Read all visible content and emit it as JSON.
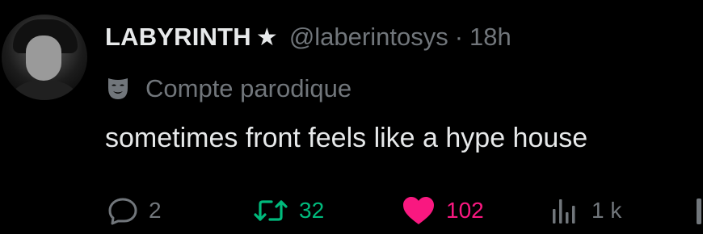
{
  "author": {
    "name": "LABYRINTH",
    "star": "★",
    "handle": "@laberintosys",
    "separator": "·",
    "time": "18h"
  },
  "parody_label": "Compte parodique",
  "tweet_text": "sometimes front feels like a hype house",
  "actions": {
    "reply_count": "2",
    "retweet_count": "32",
    "like_count": "102",
    "views_count": "1 k"
  },
  "colors": {
    "background": "#000000",
    "text": "#e7e9ea",
    "muted": "#71767b",
    "retweet_active": "#00ba7c",
    "like_active": "#f91880"
  },
  "icons": [
    "avatar",
    "mask-icon",
    "reply-icon",
    "retweet-icon",
    "heart-icon",
    "views-icon"
  ]
}
